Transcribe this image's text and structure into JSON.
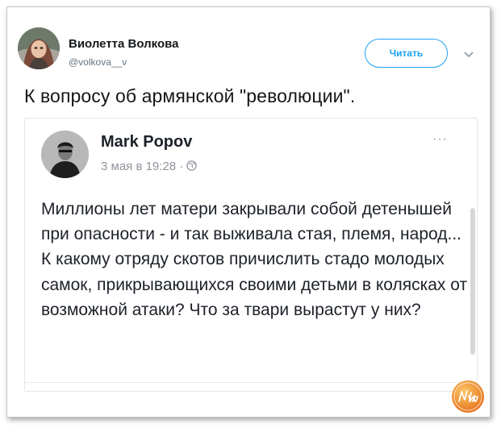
{
  "tweet": {
    "author": {
      "name": "Виолетта Волкова",
      "handle": "@volkova__v"
    },
    "follow_label": "Читать",
    "text": "К вопросу об армянской \"революции\".",
    "icons": {
      "avatar": "user-avatar",
      "caret": "chevron-down-icon"
    }
  },
  "embedded_post": {
    "author": {
      "name": "Mark Popov"
    },
    "date": "3 мая в 19:28 ·",
    "more_label": "···",
    "body": "Миллионы лет матери закрывали собой детенышей при опасности - и так выживала стая, племя, народ... К какому отряду скотов причислить стадо молодых самок, прикрывающихся своими детьми в колясках от возможной атаки? Что за твари вырастут у них?",
    "icons": {
      "privacy": "globe-icon",
      "more": "more-options-icon"
    }
  },
  "watermark": {
    "label": "Nika",
    "colors": [
      "#f5a623",
      "#e8741c"
    ]
  },
  "colors": {
    "accent": "#1da1f2",
    "text": "#14171a",
    "muted": "#657786"
  }
}
